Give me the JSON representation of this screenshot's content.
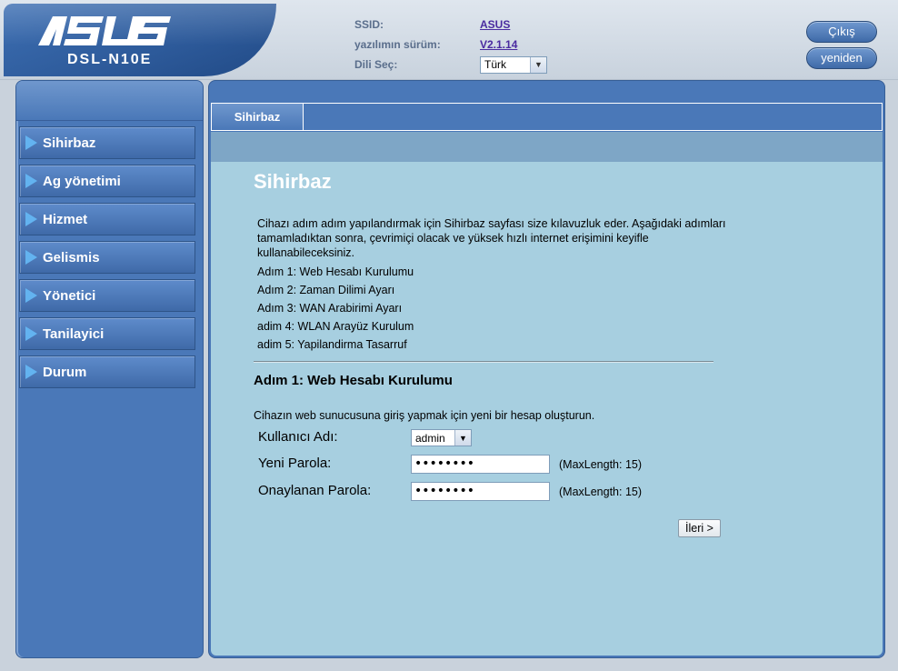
{
  "header": {
    "model": "DSL-N10E",
    "ssid_label": "SSID:",
    "ssid_value": "ASUS",
    "firmware_label": "yazılımın sürüm:",
    "firmware_value": "V2.1.14",
    "language_label": "Dili Seç:",
    "language_value": "Türk",
    "logout_label": "Çıkış",
    "reboot_label": "yeniden"
  },
  "sidebar": {
    "items": [
      {
        "label": "Sihirbaz"
      },
      {
        "label": "Ag yönetimi"
      },
      {
        "label": "Hizmet"
      },
      {
        "label": "Gelismis"
      },
      {
        "label": "Yönetici"
      },
      {
        "label": "Tanilayici"
      },
      {
        "label": "Durum"
      }
    ]
  },
  "main": {
    "tab_label": "Sihirbaz",
    "page_title": "Sihirbaz",
    "intro": "Cihazı adım adım yapılandırmak için Sihirbaz sayfası size kılavuzluk eder. Aşağıdaki adımları tamamladıktan sonra, çevrimiçi olacak ve yüksek hızlı internet erişimini keyifle kullanabileceksiniz.",
    "steps": [
      "Adım 1: Web Hesabı Kurulumu",
      "Adım 2: Zaman Dilimi Ayarı",
      "Adım 3: WAN Arabirimi Ayarı",
      "adim 4: WLAN Arayüz Kurulum",
      "adim 5: Yapilandirma Tasarruf"
    ],
    "section_title": "Adım 1: Web Hesabı Kurulumu",
    "instruction": "Cihazın web sunucusuna giriş yapmak için yeni bir hesap oluşturun.",
    "username_label": "Kullanıcı Adı:",
    "username_value": "admin",
    "new_password_label": "Yeni Parola:",
    "new_password_value": "••••••••",
    "confirm_password_label": "Onaylanan Parola:",
    "confirm_password_value": "••••••••",
    "maxlength_note": "(MaxLength: 15)",
    "next_button": "İleri >"
  },
  "colors": {
    "brand_blue": "#4a78b8",
    "content_bg": "#a7cfe0",
    "link_purple": "#4a2ba0"
  }
}
